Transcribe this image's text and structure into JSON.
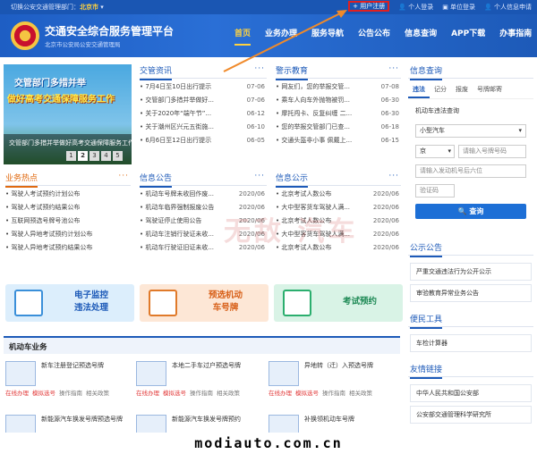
{
  "topbar": {
    "city_prefix": "切换公安交通管理部门：",
    "city": "北京市",
    "register": "+ 用户注册",
    "personal_login": "个人登录",
    "unit_login": "单位登录",
    "personal_reg": "个人信息申请"
  },
  "header": {
    "title": "交通安全综合服务管理平台",
    "subtitle": "北京市公安局公安交通管理局",
    "nav": [
      "首页",
      "业务办理",
      "服务导航",
      "公告公布",
      "信息查询",
      "APP下载",
      "办事指南"
    ]
  },
  "banner": {
    "line1": "交管部门多措并举",
    "line2": "做好高考交通保障服务工作",
    "caption": "交管部门多措并举做好高考交通保障服务工作",
    "dots": [
      "1",
      "2",
      "3",
      "4",
      "5"
    ]
  },
  "news": {
    "title": "交管资讯",
    "more": "···",
    "items": [
      {
        "text": "• 7月4日至10日出行提示",
        "date": "07-06"
      },
      {
        "text": "• 交管部门多措并举做好...",
        "date": "07-06"
      },
      {
        "text": "• 关于2020年“端午节”...",
        "date": "06-12"
      },
      {
        "text": "• 关于潮州区兴元五街施...",
        "date": "06-10"
      },
      {
        "text": "• 6月6日至12日出行提示",
        "date": "06-05"
      }
    ]
  },
  "warning": {
    "title": "警示教育",
    "more": "···",
    "items": [
      {
        "text": "• 网友们，您的举报交管...",
        "date": "07-08"
      },
      {
        "text": "• 乘车人向车外抛物被罚...",
        "date": "06-30"
      },
      {
        "text": "• 摩托闯卡、反复纠缠 二...",
        "date": "06-30"
      },
      {
        "text": "• 您的举报交管部门已查...",
        "date": "06-18"
      },
      {
        "text": "• 交通头盔非小事 佩戴上...",
        "date": "06-15"
      }
    ]
  },
  "hot": {
    "title": "业务热点",
    "more": "···",
    "items": [
      "• 驾驶人考试预约计划公布",
      "• 驾驶人考试预约结果公布",
      "• 互联网预选号牌号池公布",
      "• 驾驶人异地考试预约计划公布",
      "• 驾驶人异地考试预约结果公布"
    ]
  },
  "notice": {
    "title": "信息公告",
    "more": "···",
    "items": [
      {
        "text": "• 机动车号牌未收回作废...",
        "date": "2020/06"
      },
      {
        "text": "• 机动车临界强制报废公告",
        "date": "2020/06"
      },
      {
        "text": "• 驾驶证停止使用公告",
        "date": "2020/06"
      },
      {
        "text": "• 机动车注销行驶证未收...",
        "date": "2020/06"
      },
      {
        "text": "• 机动车行驶证旧证未收...",
        "date": "2020/06"
      }
    ]
  },
  "public": {
    "title": "信息公示",
    "more": "···",
    "items": [
      {
        "text": "• 北京考试人数公布",
        "date": "2020/06"
      },
      {
        "text": "• 大中型客货车驾驶人满...",
        "date": "2020/06"
      },
      {
        "text": "• 北京考试人数公布",
        "date": "2020/06"
      },
      {
        "text": "• 大中型客货车驾驶人满...",
        "date": "2020/06"
      },
      {
        "text": "• 北京考试人数公布",
        "date": "2020/06"
      }
    ]
  },
  "tiles": {
    "monitor": "电子监控\n违法处理",
    "plate": "预选机动\n车号牌",
    "exam": "考试预约"
  },
  "motor": {
    "title": "机动车业务",
    "services": [
      {
        "name": "新车注册登记预选号牌",
        "acts": [
          "在线办理",
          "模拟选号",
          "操作指南",
          "相关政策"
        ]
      },
      {
        "name": "本地二手车过户预选号牌",
        "acts": [
          "在线办理",
          "模拟选号",
          "操作指南",
          "相关政策"
        ]
      },
      {
        "name": "异地转（迁）入预选号牌",
        "acts": [
          "在线办理",
          "模拟选号",
          "操作指南",
          "相关政策"
        ]
      },
      {
        "name": "新能源汽车换发号牌预选号牌",
        "acts": []
      },
      {
        "name": "新能源汽车换发号牌预约",
        "acts": []
      },
      {
        "name": "补换领机动车号牌",
        "acts": []
      }
    ]
  },
  "query": {
    "title": "信息查询",
    "tabs": [
      "违法",
      "记分",
      "报废",
      "号牌邮寄"
    ],
    "subtitle": "机动车违法查询",
    "vehicle_type": "小型汽车",
    "province": "京",
    "plate_placeholder": "请输入号牌号码",
    "engine_placeholder": "请输入发动机号后六位",
    "captcha_placeholder": "验证码",
    "button": "查询"
  },
  "side_notice": {
    "title": "公示公告",
    "items": [
      "严重交通违法行为公开公示",
      "审验教育异常业务公告"
    ]
  },
  "tools": {
    "title": "便民工具",
    "items": [
      "车检计算器"
    ]
  },
  "links": {
    "title": "友情链接",
    "items": [
      "中华人民共和国公安部",
      "公安部交通管理科学研究所"
    ]
  },
  "watermark": {
    "site": "modiauto.com.cn",
    "big": "无敌 汽车"
  }
}
